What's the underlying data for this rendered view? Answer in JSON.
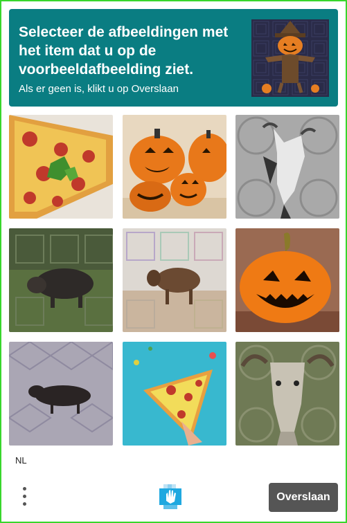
{
  "challenge": {
    "title": "Selecteer de afbeeldingen met het item dat u op de voorbeeldafbeelding ziet.",
    "subtitle": "Als er geen is, klikt u op Overslaan",
    "example_image": "pumpkin-scarecrow-image"
  },
  "grid": {
    "tiles": [
      {
        "subject": "pizza-image"
      },
      {
        "subject": "jack-o-lantern-pumpkins-image"
      },
      {
        "subject": "goat-image"
      },
      {
        "subject": "boar-image"
      },
      {
        "subject": "animal-image"
      },
      {
        "subject": "jack-o-lantern-pumpkin-image"
      },
      {
        "subject": "boar-image"
      },
      {
        "subject": "pizza-image"
      },
      {
        "subject": "goat-image"
      }
    ]
  },
  "footer": {
    "language": "NL",
    "menu_icon": "more-vertical-icon",
    "logo_icon": "hand-logo-icon",
    "skip_label": "Overslaan"
  },
  "colors": {
    "header_bg": "#0a7d82",
    "frame_border": "#38d62c",
    "skip_button_bg": "#555555"
  }
}
